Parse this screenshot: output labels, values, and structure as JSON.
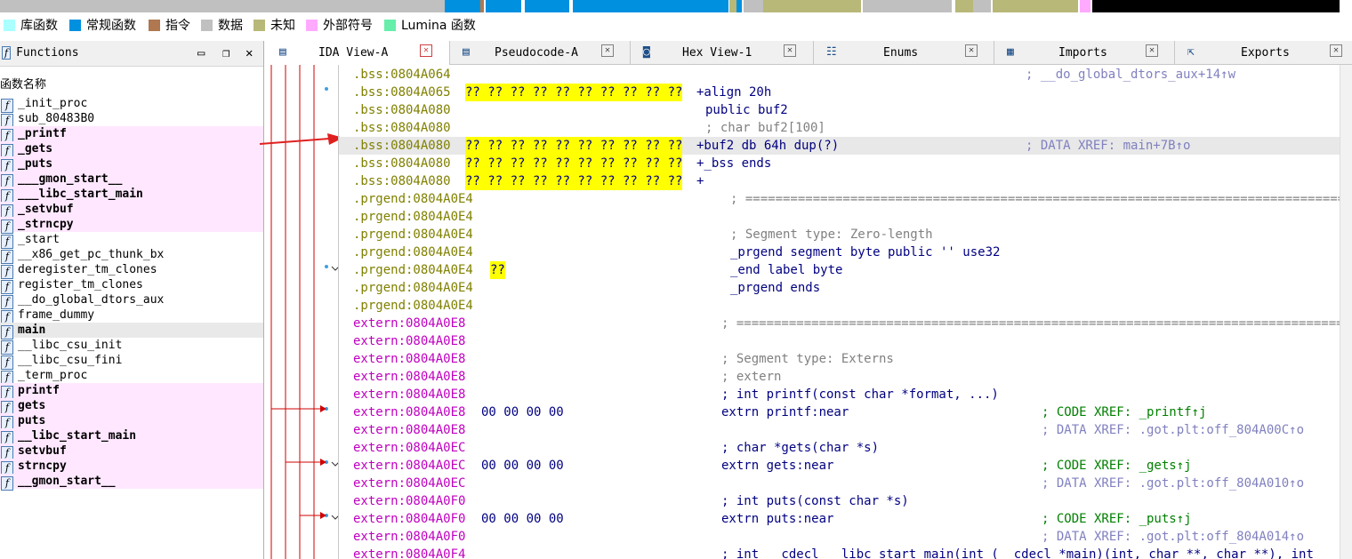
{
  "legend": [
    {
      "label": "库函数",
      "color": "#aaffff"
    },
    {
      "label": "常规函数",
      "color": "#0090e0"
    },
    {
      "label": "指令",
      "color": "#b07850"
    },
    {
      "label": "数据",
      "color": "#c0c0c0"
    },
    {
      "label": "未知",
      "color": "#b8b878"
    },
    {
      "label": "外部符号",
      "color": "#ffaaff"
    },
    {
      "label": "Lumina 函数",
      "color": "#66eeaa"
    }
  ],
  "functions_panel": {
    "title": "Functions",
    "column_header": "函数名称",
    "items": [
      {
        "name": "_init_proc",
        "type": "regular"
      },
      {
        "name": "sub_80483B0",
        "type": "regular"
      },
      {
        "name": "_printf",
        "type": "library"
      },
      {
        "name": "_gets",
        "type": "library"
      },
      {
        "name": "_puts",
        "type": "library"
      },
      {
        "name": "___gmon_start__",
        "type": "library"
      },
      {
        "name": "___libc_start_main",
        "type": "library"
      },
      {
        "name": "_setvbuf",
        "type": "library"
      },
      {
        "name": "_strncpy",
        "type": "library"
      },
      {
        "name": "_start",
        "type": "regular"
      },
      {
        "name": "__x86_get_pc_thunk_bx",
        "type": "regular"
      },
      {
        "name": "deregister_tm_clones",
        "type": "regular"
      },
      {
        "name": "register_tm_clones",
        "type": "regular"
      },
      {
        "name": "__do_global_dtors_aux",
        "type": "regular"
      },
      {
        "name": "frame_dummy",
        "type": "regular"
      },
      {
        "name": "main",
        "type": "selected"
      },
      {
        "name": "__libc_csu_init",
        "type": "regular"
      },
      {
        "name": "__libc_csu_fini",
        "type": "regular"
      },
      {
        "name": "_term_proc",
        "type": "regular"
      },
      {
        "name": "printf",
        "type": "external"
      },
      {
        "name": "gets",
        "type": "external"
      },
      {
        "name": "puts",
        "type": "external"
      },
      {
        "name": "__libc_start_main",
        "type": "external"
      },
      {
        "name": "setvbuf",
        "type": "external"
      },
      {
        "name": "strncpy",
        "type": "external"
      },
      {
        "name": "__gmon_start__",
        "type": "external"
      }
    ]
  },
  "tabs": [
    {
      "label": "IDA View-A",
      "icon": "ida-view-icon",
      "active": true
    },
    {
      "label": "Pseudocode-A",
      "icon": "pseudocode-icon",
      "active": false
    },
    {
      "label": "Hex View-1",
      "icon": "hex-view-icon",
      "active": false
    },
    {
      "label": "Enums",
      "icon": "enums-icon",
      "active": false
    },
    {
      "label": "Imports",
      "icon": "imports-icon",
      "active": false
    },
    {
      "label": "Exports",
      "icon": "exports-icon",
      "active": false
    }
  ],
  "code_lines": [
    {
      "addr": ".bss:0804A064",
      "seg": "bss",
      "bytes": "",
      "op": "",
      "comment": "; __do_global_dtors_aux+14↑w"
    },
    {
      "addr": ".bss:0804A065",
      "seg": "bss",
      "bytes": "?? ?? ?? ?? ?? ?? ?? ?? ?? ??",
      "op": "+align 20h",
      "comment": ""
    },
    {
      "addr": ".bss:0804A080",
      "seg": "bss",
      "bytes": "",
      "op": "public buf2",
      "comment": ""
    },
    {
      "addr": ".bss:0804A080",
      "seg": "bss",
      "bytes": "",
      "op": "; char buf2[100]",
      "comment": ""
    },
    {
      "addr": ".bss:0804A080",
      "seg": "bss",
      "bytes": "?? ?? ?? ?? ?? ?? ?? ?? ?? ??",
      "op": "+buf2 db 64h dup(?)",
      "comment": "; DATA XREF: main+7B↑o"
    },
    {
      "addr": ".bss:0804A080",
      "seg": "bss",
      "bytes": "?? ?? ?? ?? ?? ?? ?? ?? ?? ??",
      "op": "+_bss ends",
      "comment": ""
    },
    {
      "addr": ".bss:0804A080",
      "seg": "bss",
      "bytes": "?? ?? ?? ?? ?? ?? ?? ?? ?? ??",
      "op": "+",
      "comment": ""
    },
    {
      "addr": ".prgend:0804A0E4",
      "seg": "prgend",
      "bytes": "",
      "op": "; ====================================================================================",
      "comment": ""
    },
    {
      "addr": ".prgend:0804A0E4",
      "seg": "prgend",
      "bytes": "",
      "op": "",
      "comment": ""
    },
    {
      "addr": ".prgend:0804A0E4",
      "seg": "prgend",
      "bytes": "",
      "op": "; Segment type: Zero-length",
      "comment": ""
    },
    {
      "addr": ".prgend:0804A0E4",
      "seg": "prgend",
      "bytes": "",
      "op": "_prgend segment byte public '' use32",
      "comment": ""
    },
    {
      "addr": ".prgend:0804A0E4",
      "seg": "prgend",
      "bytes": "??",
      "op": "_end label byte",
      "comment": ""
    },
    {
      "addr": ".prgend:0804A0E4",
      "seg": "prgend",
      "bytes": "",
      "op": "_prgend ends",
      "comment": ""
    },
    {
      "addr": ".prgend:0804A0E4",
      "seg": "prgend",
      "bytes": "",
      "op": "",
      "comment": ""
    },
    {
      "addr": "extern:0804A0E8",
      "seg": "extern",
      "bytes": "",
      "op": "; ====================================================================================",
      "comment": ""
    },
    {
      "addr": "extern:0804A0E8",
      "seg": "extern",
      "bytes": "",
      "op": "",
      "comment": ""
    },
    {
      "addr": "extern:0804A0E8",
      "seg": "extern",
      "bytes": "",
      "op": "; Segment type: Externs",
      "comment": ""
    },
    {
      "addr": "extern:0804A0E8",
      "seg": "extern",
      "bytes": "",
      "op": "; extern",
      "comment": ""
    },
    {
      "addr": "extern:0804A0E8",
      "seg": "extern",
      "bytes": "",
      "op": "; int printf(const char *format, ...)",
      "comment": ""
    },
    {
      "addr": "extern:0804A0E8",
      "seg": "extern",
      "bytes": "00 00 00 00",
      "op": "extrn printf:near",
      "comment": "; CODE XREF: _printf↑j"
    },
    {
      "addr": "extern:0804A0E8",
      "seg": "extern",
      "bytes": "",
      "op": "",
      "comment": "; DATA XREF: .got.plt:off_804A00C↑o"
    },
    {
      "addr": "extern:0804A0EC",
      "seg": "extern",
      "bytes": "",
      "op": "; char *gets(char *s)",
      "comment": ""
    },
    {
      "addr": "extern:0804A0EC",
      "seg": "extern",
      "bytes": "00 00 00 00",
      "op": "extrn gets:near",
      "comment": "; CODE XREF: _gets↑j"
    },
    {
      "addr": "extern:0804A0EC",
      "seg": "extern",
      "bytes": "",
      "op": "",
      "comment": "; DATA XREF: .got.plt:off_804A010↑o"
    },
    {
      "addr": "extern:0804A0F0",
      "seg": "extern",
      "bytes": "",
      "op": "; int puts(const char *s)",
      "comment": ""
    },
    {
      "addr": "extern:0804A0F0",
      "seg": "extern",
      "bytes": "00 00 00 00",
      "op": "extrn puts:near",
      "comment": "; CODE XREF: _puts↑j"
    },
    {
      "addr": "extern:0804A0F0",
      "seg": "extern",
      "bytes": "",
      "op": "",
      "comment": "; DATA XREF: .got.plt:off_804A014↑o"
    },
    {
      "addr": "extern:0804A0F4",
      "seg": "extern",
      "bytes": "",
      "op": "; int __cdecl __libc_start_main(int (__cdecl *main)(int, char **, char **), int",
      "comment": ""
    }
  ]
}
